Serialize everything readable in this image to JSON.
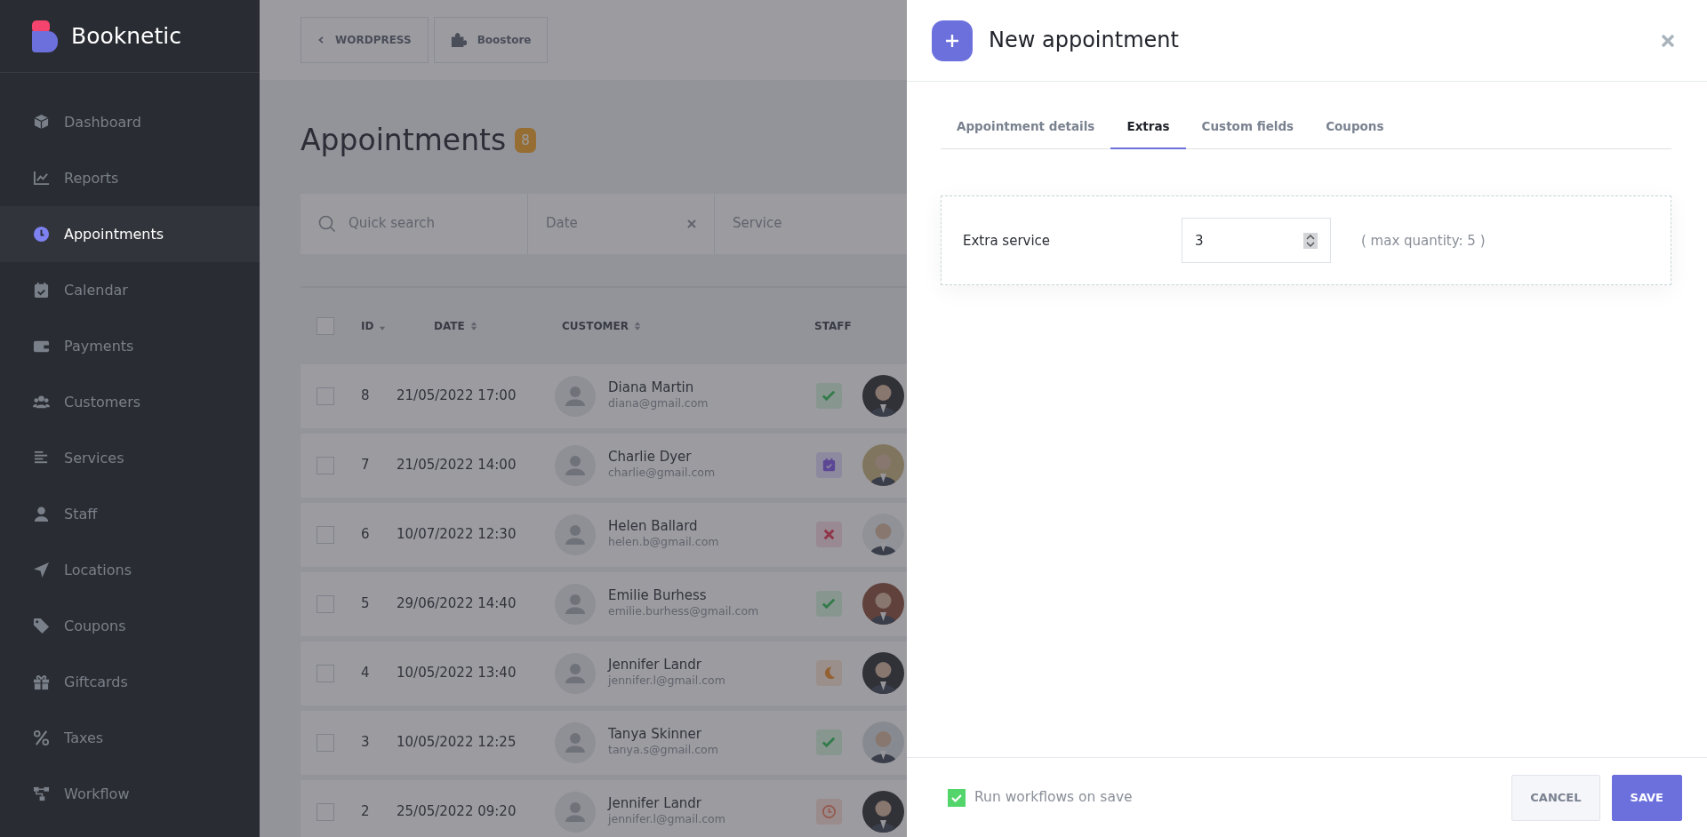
{
  "sidebar": {
    "logo": "Booknetic",
    "items": [
      {
        "label": "Dashboard",
        "selected": false
      },
      {
        "label": "Reports",
        "selected": false
      },
      {
        "label": "Appointments",
        "selected": true
      },
      {
        "label": "Calendar",
        "selected": false
      },
      {
        "label": "Payments",
        "selected": false
      },
      {
        "label": "Customers",
        "selected": false
      },
      {
        "label": "Services",
        "selected": false
      },
      {
        "label": "Staff",
        "selected": false
      },
      {
        "label": "Locations",
        "selected": false
      },
      {
        "label": "Coupons",
        "selected": false
      },
      {
        "label": "Giftcards",
        "selected": false
      },
      {
        "label": "Taxes",
        "selected": false
      },
      {
        "label": "Workflow",
        "selected": false
      }
    ]
  },
  "topbar": {
    "buttons": [
      {
        "label": "WORDPRESS"
      },
      {
        "label": "Boostore"
      }
    ]
  },
  "page": {
    "title": "Appointments",
    "count": "8"
  },
  "filters": [
    {
      "placeholder": "Quick search",
      "kind": "search"
    },
    {
      "placeholder": "Date",
      "kind": "date"
    },
    {
      "placeholder": "Service",
      "kind": "select"
    }
  ],
  "table": {
    "select_all": {
      "checked": false
    },
    "columns": [
      {
        "label": "ID"
      },
      {
        "label": "DATE"
      },
      {
        "label": "CUSTOMER"
      },
      {
        "label": "STAFF"
      }
    ],
    "rows": [
      {
        "id": "8",
        "date": "21/05/2022 17:00",
        "customer": "Diana Martin",
        "email": "diana@gmail.com",
        "kind": "approved",
        "checked": false
      },
      {
        "id": "7",
        "date": "21/05/2022 14:00",
        "customer": "Charlie Dyer",
        "email": "charlie@gmail.com",
        "kind": "rescheduled",
        "checked": false
      },
      {
        "id": "6",
        "date": "10/07/2022 12:30",
        "customer": "Helen Ballard",
        "email": "helen.b@gmail.com",
        "kind": "canceled",
        "checked": false
      },
      {
        "id": "5",
        "date": "29/06/2022 14:40",
        "customer": "Emilie Burhess",
        "email": "emilie.burhess@gmail.com",
        "kind": "approved",
        "checked": false
      },
      {
        "id": "4",
        "date": "10/05/2022 13:40",
        "customer": "Jennifer Landr",
        "email": "jennifer.l@gmail.com",
        "kind": "pending",
        "checked": false
      },
      {
        "id": "3",
        "date": "10/05/2022 12:25",
        "customer": "Tanya Skinner",
        "email": "tanya.s@gmail.com",
        "kind": "approved",
        "checked": false
      },
      {
        "id": "2",
        "date": "25/05/2022 09:20",
        "customer": "Jennifer Landr",
        "email": "jennifer.l@gmail.com",
        "kind": "waiting",
        "checked": false
      }
    ]
  },
  "modal": {
    "title": "New appointment",
    "tabs": [
      {
        "label": "Appointment details",
        "selected": false
      },
      {
        "label": "Extras",
        "selected": true
      },
      {
        "label": "Custom fields",
        "selected": false
      },
      {
        "label": "Coupons",
        "selected": false
      }
    ],
    "extras": [
      {
        "name": "Extra service",
        "quantity": "3",
        "note": "( max quantity: 5 )"
      }
    ],
    "run_workflows": {
      "label": "Run workflows on save",
      "checked": true
    },
    "buttons": [
      {
        "label": "CANCEL",
        "kind": "secondary"
      },
      {
        "label": "SAVE",
        "kind": "primary"
      }
    ]
  }
}
